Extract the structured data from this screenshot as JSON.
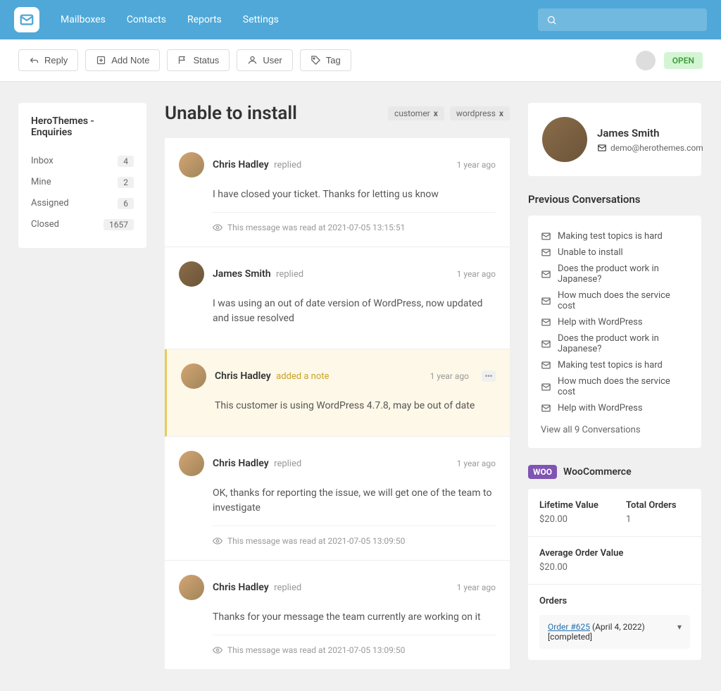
{
  "nav": {
    "links": [
      "Mailboxes",
      "Contacts",
      "Reports",
      "Settings"
    ]
  },
  "toolbar": {
    "reply": "Reply",
    "add_note": "Add Note",
    "status": "Status",
    "user": "User",
    "tag": "Tag",
    "open_status": "OPEN"
  },
  "sidebar": {
    "title": "HeroThemes - Enquiries",
    "items": [
      {
        "label": "Inbox",
        "count": "4"
      },
      {
        "label": "Mine",
        "count": "2"
      },
      {
        "label": "Assigned",
        "count": "6"
      },
      {
        "label": "Closed",
        "count": "1657"
      }
    ]
  },
  "ticket": {
    "title": "Unable to install",
    "tags": [
      "customer",
      "wordpress"
    ]
  },
  "messages": [
    {
      "author": "Chris Hadley",
      "action": "replied",
      "time": "1 year ago",
      "body": "I have closed your ticket. Thanks for letting us know",
      "read": "This message was read at 2021-07-05 13:15:51",
      "type": "reply"
    },
    {
      "author": "James Smith",
      "action": "replied",
      "time": "1 year ago",
      "body": "I was using an out of date version of WordPress, now updated and issue resolved",
      "type": "reply",
      "customer": true
    },
    {
      "author": "Chris Hadley",
      "action": "added a note",
      "time": "1 year ago",
      "body": "This customer is using WordPress 4.7.8, may be out of date",
      "type": "note",
      "more": true
    },
    {
      "author": "Chris Hadley",
      "action": "replied",
      "time": "1 year ago",
      "body": "OK, thanks for reporting the issue, we will get one of the team to investigate",
      "read": "This message was read at 2021-07-05 13:09:50",
      "type": "reply"
    },
    {
      "author": "Chris Hadley",
      "action": "replied",
      "time": "1 year ago",
      "body": "Thanks for your message the team currently are working on it",
      "read": "This message was read at 2021-07-05 13:09:50",
      "type": "reply"
    }
  ],
  "customer": {
    "name": "James Smith",
    "email": "demo@herothemes.com"
  },
  "prev_conv": {
    "heading": "Previous Conversations",
    "items": [
      "Making test topics is hard",
      "Unable to install",
      "Does the product work in Japanese?",
      "How much does the service cost",
      "Help with WordPress",
      "Does the product work in Japanese?",
      "Making test topics is hard",
      "How much does the service cost",
      "Help with WordPress"
    ],
    "view_all": "View all 9 Conversations"
  },
  "woo": {
    "title": "WooCommerce",
    "badge": "WOO",
    "lifetime_label": "Lifetime Value",
    "lifetime_value": "$20.00",
    "total_orders_label": "Total Orders",
    "total_orders_value": "1",
    "avg_label": "Average Order Value",
    "avg_value": "$20.00",
    "orders_label": "Orders",
    "order_link": "Order #625",
    "order_date": " (April 4, 2022)",
    "order_status": "[completed]"
  }
}
